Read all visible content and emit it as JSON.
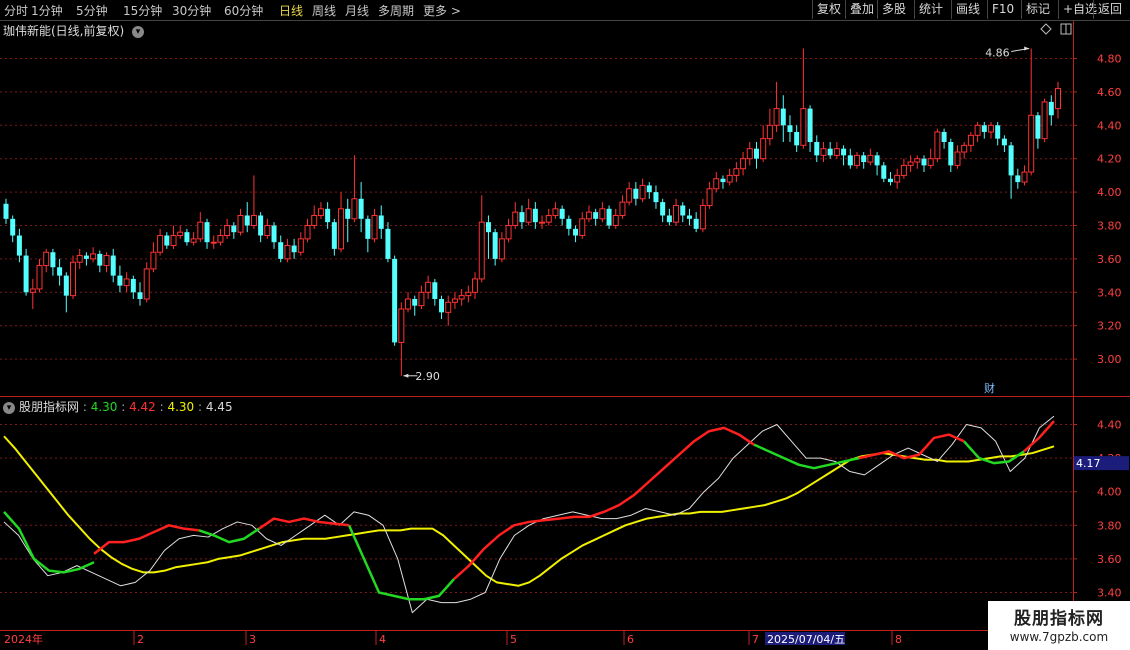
{
  "toolbar": {
    "periods": [
      "分时",
      "1分钟",
      "5分钟",
      "15分钟",
      "30分钟",
      "60分钟",
      "日线",
      "周线",
      "月线",
      "多周期",
      "更多 >"
    ],
    "active_period": "日线",
    "right_buttons": [
      "复权",
      "叠加",
      "多股",
      "统计",
      "画线",
      "F10",
      "标记",
      "+自选",
      "返回"
    ]
  },
  "main_chart": {
    "title": "珈伟新能(日线,前复权)",
    "price_ticks": [
      "4.80",
      "4.60",
      "4.40",
      "4.20",
      "4.00",
      "3.80",
      "3.60",
      "3.40",
      "3.20",
      "3.00"
    ],
    "high_label": "4.86",
    "low_label": "2.90",
    "fin_badge": "财",
    "candles": [
      [
        3.93,
        3.84,
        3.96,
        3.81
      ],
      [
        3.84,
        3.74,
        3.86,
        3.7
      ],
      [
        3.74,
        3.62,
        3.78,
        3.58
      ],
      [
        3.62,
        3.4,
        3.66,
        3.38
      ],
      [
        3.4,
        3.42,
        3.48,
        3.3
      ],
      [
        3.42,
        3.56,
        3.6,
        3.4
      ],
      [
        3.56,
        3.64,
        3.66,
        3.52
      ],
      [
        3.64,
        3.55,
        3.66,
        3.5
      ],
      [
        3.55,
        3.5,
        3.6,
        3.44
      ],
      [
        3.5,
        3.38,
        3.52,
        3.28
      ],
      [
        3.38,
        3.58,
        3.62,
        3.36
      ],
      [
        3.58,
        3.62,
        3.66,
        3.54
      ],
      [
        3.62,
        3.6,
        3.64,
        3.56
      ],
      [
        3.6,
        3.63,
        3.67,
        3.58
      ],
      [
        3.63,
        3.56,
        3.65,
        3.52
      ],
      [
        3.56,
        3.62,
        3.64,
        3.52
      ],
      [
        3.62,
        3.5,
        3.66,
        3.46
      ],
      [
        3.5,
        3.44,
        3.56,
        3.4
      ],
      [
        3.44,
        3.48,
        3.52,
        3.4
      ],
      [
        3.48,
        3.4,
        3.5,
        3.36
      ],
      [
        3.4,
        3.36,
        3.46,
        3.32
      ],
      [
        3.36,
        3.54,
        3.58,
        3.34
      ],
      [
        3.54,
        3.64,
        3.7,
        3.52
      ],
      [
        3.64,
        3.74,
        3.78,
        3.62
      ],
      [
        3.74,
        3.68,
        3.76,
        3.66
      ],
      [
        3.68,
        3.74,
        3.8,
        3.66
      ],
      [
        3.74,
        3.76,
        3.8,
        3.72
      ],
      [
        3.76,
        3.7,
        3.78,
        3.68
      ],
      [
        3.7,
        3.72,
        3.76,
        3.68
      ],
      [
        3.72,
        3.82,
        3.88,
        3.7
      ],
      [
        3.82,
        3.7,
        3.84,
        3.66
      ],
      [
        3.7,
        3.7,
        3.74,
        3.66
      ],
      [
        3.7,
        3.74,
        3.78,
        3.68
      ],
      [
        3.74,
        3.8,
        3.84,
        3.72
      ],
      [
        3.8,
        3.76,
        3.82,
        3.72
      ],
      [
        3.76,
        3.86,
        3.9,
        3.74
      ],
      [
        3.86,
        3.8,
        3.94,
        3.76
      ],
      [
        3.8,
        3.86,
        4.1,
        3.78
      ],
      [
        3.86,
        3.74,
        3.88,
        3.7
      ],
      [
        3.74,
        3.8,
        3.84,
        3.72
      ],
      [
        3.8,
        3.7,
        3.82,
        3.66
      ],
      [
        3.7,
        3.6,
        3.74,
        3.58
      ],
      [
        3.6,
        3.68,
        3.72,
        3.58
      ],
      [
        3.68,
        3.64,
        3.72,
        3.6
      ],
      [
        3.64,
        3.72,
        3.76,
        3.62
      ],
      [
        3.72,
        3.8,
        3.84,
        3.7
      ],
      [
        3.8,
        3.86,
        3.92,
        3.78
      ],
      [
        3.86,
        3.9,
        3.94,
        3.84
      ],
      [
        3.9,
        3.82,
        3.94,
        3.78
      ],
      [
        3.82,
        3.66,
        3.84,
        3.62
      ],
      [
        3.66,
        3.9,
        4.0,
        3.64
      ],
      [
        3.9,
        3.84,
        3.96,
        3.7
      ],
      [
        3.84,
        3.96,
        4.22,
        3.82
      ],
      [
        3.96,
        3.84,
        4.06,
        3.76
      ],
      [
        3.84,
        3.72,
        3.86,
        3.64
      ],
      [
        3.72,
        3.86,
        3.9,
        3.7
      ],
      [
        3.86,
        3.78,
        3.92,
        3.72
      ],
      [
        3.78,
        3.6,
        3.82,
        3.58
      ],
      [
        3.6,
        3.1,
        3.62,
        3.08
      ],
      [
        3.1,
        3.3,
        3.34,
        2.9
      ],
      [
        3.3,
        3.36,
        3.4,
        3.28
      ],
      [
        3.36,
        3.32,
        3.38,
        3.26
      ],
      [
        3.32,
        3.4,
        3.44,
        3.3
      ],
      [
        3.4,
        3.46,
        3.5,
        3.36
      ],
      [
        3.46,
        3.36,
        3.48,
        3.32
      ],
      [
        3.36,
        3.28,
        3.38,
        3.24
      ],
      [
        3.28,
        3.34,
        3.38,
        3.2
      ],
      [
        3.34,
        3.36,
        3.4,
        3.3
      ],
      [
        3.36,
        3.38,
        3.42,
        3.32
      ],
      [
        3.38,
        3.4,
        3.44,
        3.34
      ],
      [
        3.4,
        3.48,
        3.52,
        3.36
      ],
      [
        3.48,
        3.82,
        3.98,
        3.46
      ],
      [
        3.82,
        3.76,
        3.86,
        3.6
      ],
      [
        3.76,
        3.6,
        3.78,
        3.56
      ],
      [
        3.6,
        3.72,
        3.76,
        3.58
      ],
      [
        3.72,
        3.8,
        3.84,
        3.7
      ],
      [
        3.8,
        3.88,
        3.94,
        3.78
      ],
      [
        3.88,
        3.82,
        3.92,
        3.78
      ],
      [
        3.82,
        3.9,
        3.96,
        3.8
      ],
      [
        3.9,
        3.82,
        3.94,
        3.78
      ],
      [
        3.82,
        3.82,
        3.86,
        3.78
      ],
      [
        3.82,
        3.86,
        3.9,
        3.8
      ],
      [
        3.86,
        3.9,
        3.94,
        3.84
      ],
      [
        3.9,
        3.84,
        3.92,
        3.8
      ],
      [
        3.84,
        3.78,
        3.86,
        3.74
      ],
      [
        3.78,
        3.74,
        3.8,
        3.7
      ],
      [
        3.74,
        3.84,
        3.88,
        3.72
      ],
      [
        3.84,
        3.88,
        3.92,
        3.82
      ],
      [
        3.88,
        3.84,
        3.9,
        3.8
      ],
      [
        3.84,
        3.9,
        3.94,
        3.82
      ],
      [
        3.9,
        3.8,
        3.92,
        3.78
      ],
      [
        3.8,
        3.86,
        3.9,
        3.78
      ],
      [
        3.86,
        3.94,
        3.98,
        3.84
      ],
      [
        3.94,
        4.02,
        4.06,
        3.92
      ],
      [
        4.02,
        3.96,
        4.06,
        3.92
      ],
      [
        3.96,
        4.04,
        4.08,
        3.94
      ],
      [
        4.04,
        4.0,
        4.06,
        3.96
      ],
      [
        4.0,
        3.94,
        4.04,
        3.9
      ],
      [
        3.94,
        3.86,
        3.96,
        3.82
      ],
      [
        3.86,
        3.82,
        3.9,
        3.8
      ],
      [
        3.82,
        3.92,
        3.96,
        3.8
      ],
      [
        3.92,
        3.86,
        3.94,
        3.82
      ],
      [
        3.86,
        3.84,
        3.9,
        3.8
      ],
      [
        3.84,
        3.78,
        3.88,
        3.76
      ],
      [
        3.78,
        3.92,
        3.96,
        3.76
      ],
      [
        3.92,
        4.02,
        4.06,
        3.9
      ],
      [
        4.02,
        4.08,
        4.12,
        4.0
      ],
      [
        4.08,
        4.06,
        4.1,
        4.02
      ],
      [
        4.06,
        4.1,
        4.14,
        4.04
      ],
      [
        4.1,
        4.14,
        4.18,
        4.06
      ],
      [
        4.14,
        4.2,
        4.24,
        4.1
      ],
      [
        4.2,
        4.26,
        4.3,
        4.16
      ],
      [
        4.26,
        4.2,
        4.3,
        4.14
      ],
      [
        4.2,
        4.32,
        4.4,
        4.18
      ],
      [
        4.32,
        4.4,
        4.5,
        4.28
      ],
      [
        4.4,
        4.5,
        4.66,
        4.36
      ],
      [
        4.5,
        4.4,
        4.58,
        4.3
      ],
      [
        4.4,
        4.36,
        4.46,
        4.3
      ],
      [
        4.36,
        4.28,
        4.4,
        4.24
      ],
      [
        4.28,
        4.5,
        4.86,
        4.26
      ],
      [
        4.5,
        4.3,
        4.52,
        4.24
      ],
      [
        4.3,
        4.22,
        4.34,
        4.18
      ],
      [
        4.22,
        4.26,
        4.3,
        4.18
      ],
      [
        4.26,
        4.22,
        4.3,
        4.2
      ],
      [
        4.22,
        4.26,
        4.3,
        4.2
      ],
      [
        4.26,
        4.22,
        4.28,
        4.16
      ],
      [
        4.22,
        4.16,
        4.26,
        4.14
      ],
      [
        4.16,
        4.22,
        4.24,
        4.14
      ],
      [
        4.22,
        4.18,
        4.24,
        4.14
      ],
      [
        4.18,
        4.22,
        4.26,
        4.16
      ],
      [
        4.22,
        4.16,
        4.24,
        4.1
      ],
      [
        4.16,
        4.08,
        4.18,
        4.06
      ],
      [
        4.08,
        4.06,
        4.12,
        4.04
      ],
      [
        4.06,
        4.1,
        4.14,
        4.02
      ],
      [
        4.1,
        4.16,
        4.2,
        4.08
      ],
      [
        4.16,
        4.18,
        4.22,
        4.12
      ],
      [
        4.18,
        4.2,
        4.22,
        4.14
      ],
      [
        4.2,
        4.16,
        4.22,
        4.12
      ],
      [
        4.16,
        4.2,
        4.26,
        4.14
      ],
      [
        4.2,
        4.36,
        4.38,
        4.18
      ],
      [
        4.36,
        4.3,
        4.38,
        4.26
      ],
      [
        4.3,
        4.16,
        4.32,
        4.12
      ],
      [
        4.16,
        4.24,
        4.28,
        4.14
      ],
      [
        4.24,
        4.28,
        4.3,
        4.2
      ],
      [
        4.28,
        4.34,
        4.36,
        4.24
      ],
      [
        4.34,
        4.4,
        4.42,
        4.3
      ],
      [
        4.4,
        4.36,
        4.42,
        4.32
      ],
      [
        4.36,
        4.4,
        4.42,
        4.32
      ],
      [
        4.4,
        4.32,
        4.42,
        4.28
      ],
      [
        4.32,
        4.28,
        4.34,
        4.24
      ],
      [
        4.28,
        4.1,
        4.3,
        3.96
      ],
      [
        4.1,
        4.06,
        4.14,
        4.02
      ],
      [
        4.06,
        4.12,
        4.16,
        4.04
      ],
      [
        4.12,
        4.46,
        4.86,
        4.1
      ],
      [
        4.46,
        4.32,
        4.48,
        4.26
      ],
      [
        4.32,
        4.54,
        4.56,
        4.3
      ],
      [
        4.54,
        4.46,
        4.58,
        4.4
      ],
      [
        4.5,
        4.62,
        4.66,
        4.44
      ]
    ]
  },
  "indicator": {
    "name": "股朋指标网",
    "values": [
      "4.30",
      "4.42",
      "4.30",
      "4.45"
    ],
    "colors": [
      "#22d822",
      "#ff3030",
      "#f0f000",
      "#d8d8d8"
    ],
    "ticks": [
      "4.40",
      "4.20",
      "4.00",
      "3.80",
      "3.60",
      "3.40"
    ],
    "current_tag": "4.17",
    "yellow_line": [
      4.33,
      4.26,
      4.18,
      4.1,
      4.02,
      3.94,
      3.86,
      3.79,
      3.72,
      3.66,
      3.61,
      3.57,
      3.54,
      3.52,
      3.52,
      3.53,
      3.55,
      3.56,
      3.57,
      3.58,
      3.6,
      3.61,
      3.62,
      3.64,
      3.66,
      3.68,
      3.7,
      3.71,
      3.72,
      3.72,
      3.72,
      3.73,
      3.74,
      3.75,
      3.76,
      3.77,
      3.77,
      3.77,
      3.78,
      3.78,
      3.78,
      3.74,
      3.68,
      3.62,
      3.56,
      3.5,
      3.46,
      3.45,
      3.44,
      3.46,
      3.5,
      3.55,
      3.6,
      3.64,
      3.68,
      3.71,
      3.74,
      3.77,
      3.8,
      3.82,
      3.84,
      3.85,
      3.86,
      3.87,
      3.87,
      3.88,
      3.88,
      3.88,
      3.89,
      3.9,
      3.91,
      3.92,
      3.94,
      3.96,
      3.99,
      4.03,
      4.07,
      4.11,
      4.15,
      4.19,
      4.21,
      4.22,
      4.23,
      4.22,
      4.21,
      4.2,
      4.19,
      4.19,
      4.18,
      4.18,
      4.18,
      4.19,
      4.2,
      4.21,
      4.21,
      4.22,
      4.23,
      4.25,
      4.27
    ],
    "white_line": [
      3.82,
      3.74,
      3.6,
      3.5,
      3.52,
      3.56,
      3.52,
      3.48,
      3.44,
      3.46,
      3.53,
      3.65,
      3.72,
      3.74,
      3.73,
      3.78,
      3.82,
      3.8,
      3.72,
      3.68,
      3.74,
      3.8,
      3.86,
      3.8,
      3.88,
      3.86,
      3.8,
      3.6,
      3.28,
      3.36,
      3.34,
      3.34,
      3.36,
      3.4,
      3.6,
      3.74,
      3.8,
      3.84,
      3.86,
      3.88,
      3.86,
      3.84,
      3.84,
      3.86,
      3.9,
      3.88,
      3.86,
      3.9,
      4.0,
      4.08,
      4.2,
      4.28,
      4.36,
      4.4,
      4.3,
      4.2,
      4.2,
      4.18,
      4.12,
      4.1,
      4.16,
      4.22,
      4.26,
      4.22,
      4.18,
      4.28,
      4.4,
      4.38,
      4.3,
      4.12,
      4.2,
      4.38,
      4.45
    ],
    "red_segments": [
      [
        [
          12,
          3.63
        ],
        [
          14,
          3.7
        ],
        [
          16,
          3.7
        ],
        [
          18,
          3.72
        ],
        [
          20,
          3.76
        ],
        [
          22,
          3.8
        ],
        [
          24,
          3.78
        ],
        [
          26,
          3.77
        ]
      ],
      [
        [
          34,
          3.78
        ],
        [
          36,
          3.84
        ],
        [
          38,
          3.82
        ],
        [
          40,
          3.84
        ],
        [
          42,
          3.82
        ],
        [
          44,
          3.81
        ],
        [
          46,
          3.8
        ]
      ],
      [
        [
          60,
          3.48
        ],
        [
          62,
          3.56
        ],
        [
          64,
          3.66
        ],
        [
          66,
          3.74
        ],
        [
          68,
          3.8
        ],
        [
          70,
          3.82
        ],
        [
          72,
          3.83
        ],
        [
          74,
          3.84
        ],
        [
          76,
          3.85
        ],
        [
          78,
          3.85
        ],
        [
          80,
          3.88
        ],
        [
          82,
          3.92
        ],
        [
          84,
          3.98
        ],
        [
          86,
          4.06
        ],
        [
          88,
          4.14
        ],
        [
          90,
          4.22
        ],
        [
          92,
          4.3
        ],
        [
          94,
          4.36
        ],
        [
          96,
          4.38
        ],
        [
          98,
          4.34
        ],
        [
          100,
          4.28
        ]
      ],
      [
        [
          114,
          4.2
        ],
        [
          116,
          4.22
        ],
        [
          118,
          4.24
        ],
        [
          120,
          4.2
        ],
        [
          122,
          4.22
        ],
        [
          124,
          4.32
        ],
        [
          126,
          4.34
        ],
        [
          128,
          4.3
        ]
      ],
      [
        [
          136,
          4.24
        ],
        [
          138,
          4.32
        ],
        [
          140,
          4.42
        ]
      ]
    ],
    "green_segments": [
      [
        [
          0,
          3.88
        ],
        [
          2,
          3.78
        ],
        [
          4,
          3.6
        ],
        [
          6,
          3.53
        ],
        [
          8,
          3.52
        ],
        [
          10,
          3.54
        ],
        [
          12,
          3.58
        ]
      ],
      [
        [
          26,
          3.77
        ],
        [
          28,
          3.74
        ],
        [
          30,
          3.7
        ],
        [
          32,
          3.72
        ],
        [
          34,
          3.78
        ]
      ],
      [
        [
          46,
          3.8
        ],
        [
          48,
          3.6
        ],
        [
          50,
          3.4
        ],
        [
          52,
          3.38
        ],
        [
          54,
          3.36
        ],
        [
          56,
          3.36
        ],
        [
          58,
          3.38
        ],
        [
          60,
          3.48
        ]
      ],
      [
        [
          100,
          4.28
        ],
        [
          102,
          4.24
        ],
        [
          104,
          4.2
        ],
        [
          106,
          4.16
        ],
        [
          108,
          4.14
        ],
        [
          110,
          4.16
        ],
        [
          112,
          4.18
        ],
        [
          114,
          4.2
        ]
      ],
      [
        [
          128,
          4.3
        ],
        [
          130,
          4.2
        ],
        [
          132,
          4.17
        ],
        [
          134,
          4.18
        ],
        [
          136,
          4.24
        ]
      ]
    ]
  },
  "x_axis": {
    "year_label": "2024年",
    "months": [
      "2",
      "3",
      "4",
      "5",
      "6",
      "7",
      "8"
    ],
    "date_label": "2025/07/04/五"
  },
  "watermark": {
    "line1": "股朋指标网",
    "line2": "www.7gpzb.com"
  }
}
